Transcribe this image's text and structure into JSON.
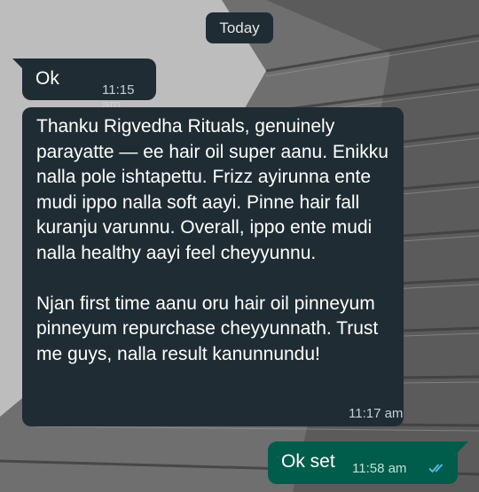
{
  "date_chip": "Today",
  "messages": [
    {
      "text": "Ok",
      "time": "11:15 am"
    },
    {
      "text": "Thanku Rigvedha Rituals, genuinely parayatte — ee hair oil super aanu. Enikku nalla pole ishtapettu. Frizz ayirunna ente mudi ippo nalla soft aayi. Pinne hair fall kuranju varunnu. Overall, ippo ente mudi nalla healthy aayi feel cheyyunnu.\n\nNjan first time aanu oru hair oil pinneyum pinneyum repurchase cheyyunnath. Trust me guys, nalla result kanunnundu!",
      "time": "11:17 am"
    },
    {
      "text": "Ok set",
      "time": "11:58 am",
      "status_icon": "double-check-read-icon",
      "status_color": "#53bdeb"
    }
  ]
}
